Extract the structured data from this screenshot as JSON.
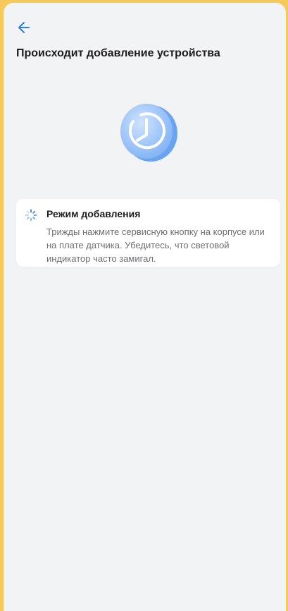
{
  "header": {
    "back_icon": "arrow-left-icon",
    "title": "Происходит добавление устройства"
  },
  "illustration": {
    "icon": "clock-icon"
  },
  "mode_card": {
    "icon": "loading-spinner-icon",
    "title": "Режим добавления",
    "description": "Трижды нажмите сервисную кнопку на корпусе или на плате датчика. Убедитесь, что световой индикатор часто замигал."
  },
  "colors": {
    "accent": "#2f7fe0",
    "background": "#f2f3f5",
    "card": "#ffffff",
    "title_text": "#1c1c1e",
    "secondary_text": "#6e6e73"
  }
}
